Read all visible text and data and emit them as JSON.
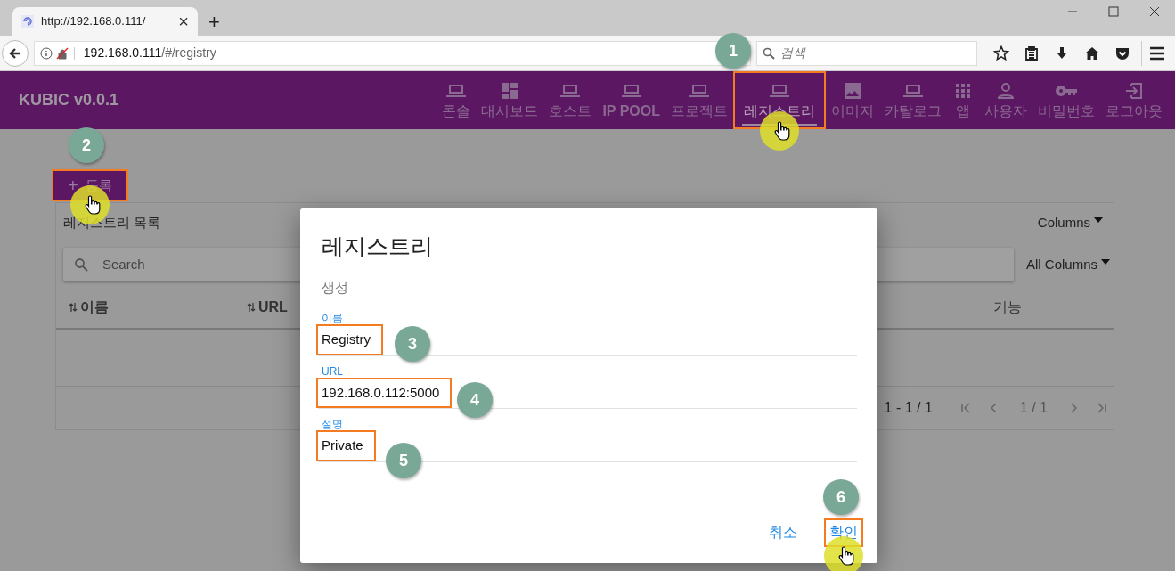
{
  "browser": {
    "tab_title": "http://192.168.0.111/",
    "tab_close": "×",
    "new_tab": "+",
    "url_host": "192.168.0.111",
    "url_path": "/#/registry",
    "search_placeholder": "검색"
  },
  "app": {
    "brand": "KUBIC v0.0.1",
    "nav": [
      {
        "label": "콘솔",
        "kind": "laptop",
        "bold": false,
        "selected": false,
        "highlighted": false,
        "cursor": false
      },
      {
        "label": "대시보드",
        "kind": "dashboard",
        "bold": false,
        "selected": false,
        "highlighted": false,
        "cursor": false
      },
      {
        "label": "호스트",
        "kind": "laptop",
        "bold": false,
        "selected": false,
        "highlighted": false,
        "cursor": false
      },
      {
        "label": "IP POOL",
        "kind": "laptop",
        "bold": true,
        "selected": false,
        "highlighted": false,
        "cursor": false
      },
      {
        "label": "프로젝트",
        "kind": "laptop",
        "bold": false,
        "selected": false,
        "highlighted": false,
        "cursor": false
      },
      {
        "label": "레지스트리",
        "kind": "laptop",
        "bold": false,
        "selected": true,
        "highlighted": true,
        "cursor": true
      },
      {
        "label": "이미지",
        "kind": "image",
        "bold": false,
        "selected": false,
        "highlighted": false,
        "cursor": false
      },
      {
        "label": "카탈로그",
        "kind": "laptop",
        "bold": false,
        "selected": false,
        "highlighted": false,
        "cursor": false
      },
      {
        "label": "앱",
        "kind": "apps",
        "bold": false,
        "selected": false,
        "highlighted": false,
        "cursor": false
      },
      {
        "label": "사용자",
        "kind": "person",
        "bold": false,
        "selected": false,
        "highlighted": false,
        "cursor": false
      },
      {
        "label": "비밀번호",
        "kind": "key",
        "bold": false,
        "selected": false,
        "highlighted": false,
        "cursor": false
      },
      {
        "label": "로그아웃",
        "kind": "logout",
        "bold": false,
        "selected": false,
        "highlighted": false,
        "cursor": false
      }
    ]
  },
  "add_button": {
    "icon": "+",
    "label": "등록",
    "highlighted": true,
    "cursor": true
  },
  "list": {
    "title": "레지스트리 목록",
    "columns_menu": "Columns",
    "search_placeholder": "Search",
    "filter_menu": "All Columns",
    "columns": [
      {
        "label": "이름",
        "sortable": true
      },
      {
        "label": "URL",
        "sortable": true
      },
      {
        "label": "기능",
        "sortable": false
      }
    ],
    "range": "1 - 1 / 1",
    "page": "1 / 1"
  },
  "dialog": {
    "title": "레지스트리",
    "subtitle": "생성",
    "fields": [
      {
        "label": "이름",
        "value": "Registry",
        "highlighted": true
      },
      {
        "label": "URL",
        "value": "192.168.0.112:5000",
        "highlighted": true
      },
      {
        "label": "설명",
        "value": "Private",
        "highlighted": true
      }
    ],
    "buttons": [
      {
        "label": "취소",
        "highlighted": false,
        "cursor": false
      },
      {
        "label": "확인",
        "highlighted": true,
        "cursor": true
      }
    ]
  },
  "annotations": [
    {
      "number": "1"
    },
    {
      "number": "2"
    },
    {
      "number": "3"
    },
    {
      "number": "4"
    },
    {
      "number": "5"
    },
    {
      "number": "6"
    }
  ]
}
